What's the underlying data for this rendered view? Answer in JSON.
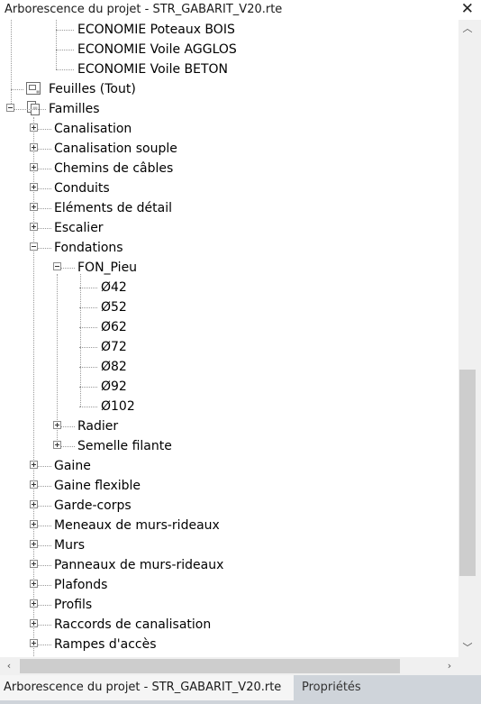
{
  "title_bar": {
    "title": "Arborescence du projet - STR_GABARIT_V20.rte",
    "close_glyph": "✕"
  },
  "tree": {
    "items": [
      {
        "label": "ECONOMIE Poteaux BOIS",
        "name": "tree-item-economie-poteaux-bois"
      },
      {
        "label": "ECONOMIE Voile AGGLOS",
        "name": "tree-item-economie-voile-agglos"
      },
      {
        "label": "ECONOMIE Voile BETON",
        "name": "tree-item-economie-voile-beton"
      },
      {
        "label": "Feuilles (Tout)",
        "name": "tree-item-feuilles",
        "icon": "sheets-icon"
      },
      {
        "label": "Familles",
        "name": "tree-item-familles",
        "icon": "families-icon"
      },
      {
        "label": "Canalisation",
        "name": "tree-item-canalisation"
      },
      {
        "label": "Canalisation souple",
        "name": "tree-item-canalisation-souple"
      },
      {
        "label": "Chemins de câbles",
        "name": "tree-item-chemins-de-cables"
      },
      {
        "label": "Conduits",
        "name": "tree-item-conduits"
      },
      {
        "label": "Eléments de détail",
        "name": "tree-item-elements-de-detail"
      },
      {
        "label": "Escalier",
        "name": "tree-item-escalier"
      },
      {
        "label": "Fondations",
        "name": "tree-item-fondations"
      },
      {
        "label": "FON_Pieu",
        "name": "tree-item-fon-pieu"
      },
      {
        "label": "Ø42",
        "name": "tree-item-d42"
      },
      {
        "label": "Ø52",
        "name": "tree-item-d52"
      },
      {
        "label": "Ø62",
        "name": "tree-item-d62"
      },
      {
        "label": "Ø72",
        "name": "tree-item-d72"
      },
      {
        "label": "Ø82",
        "name": "tree-item-d82"
      },
      {
        "label": "Ø92",
        "name": "tree-item-d92"
      },
      {
        "label": "Ø102",
        "name": "tree-item-d102"
      },
      {
        "label": "Radier",
        "name": "tree-item-radier"
      },
      {
        "label": "Semelle filante",
        "name": "tree-item-semelle-filante"
      },
      {
        "label": "Gaine",
        "name": "tree-item-gaine"
      },
      {
        "label": "Gaine flexible",
        "name": "tree-item-gaine-flexible"
      },
      {
        "label": "Garde-corps",
        "name": "tree-item-garde-corps"
      },
      {
        "label": "Meneaux de murs-rideaux",
        "name": "tree-item-meneaux"
      },
      {
        "label": "Murs",
        "name": "tree-item-murs"
      },
      {
        "label": "Panneaux de murs-rideaux",
        "name": "tree-item-panneaux"
      },
      {
        "label": "Plafonds",
        "name": "tree-item-plafonds"
      },
      {
        "label": "Profils",
        "name": "tree-item-profils"
      },
      {
        "label": "Raccords de canalisation",
        "name": "tree-item-raccords"
      },
      {
        "label": "Rampes d'accès",
        "name": "tree-item-rampes"
      }
    ]
  },
  "scrollbars": {
    "up_glyph": "︿",
    "down_glyph": "﹀",
    "left_glyph": "‹",
    "right_glyph": "›"
  },
  "tabs": [
    {
      "label": "Arborescence du projet - STR_GABARIT_V20.rte",
      "active": true
    },
    {
      "label": "Propriétés",
      "active": false
    }
  ],
  "colors": {
    "tab_bar": "#cfd4da",
    "scroll_track": "#f0f0f0",
    "scroll_thumb": "#cdcdcd",
    "tree_lines": "#9a9a9a"
  }
}
